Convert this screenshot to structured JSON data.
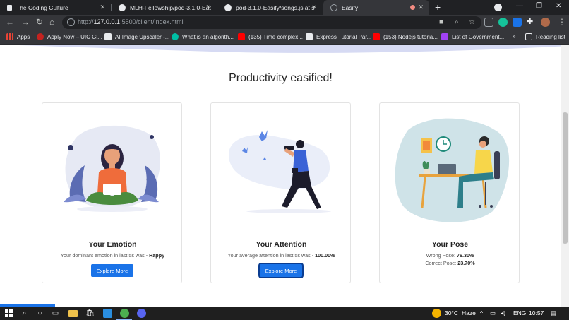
{
  "browser": {
    "tabs": [
      {
        "title": "The Coding Culture",
        "icon": "lock-icon",
        "icon_color": "#e8eaed"
      },
      {
        "title": "MLH-Fellowship/pod-3.1.0-Easif",
        "icon": "github-icon",
        "icon_color": "#e8eaed"
      },
      {
        "title": "pod-3.1.0-Easify/songs.js at song",
        "icon": "github-icon",
        "icon_color": "#e8eaed"
      },
      {
        "title": "Easify",
        "icon": "globe-icon",
        "icon_color": "#9aa0a6",
        "active": true
      }
    ],
    "url_host": "127.0.0.1",
    "url_path": ":5500/client/index.html",
    "url_scheme": "http://",
    "bookmarks": [
      {
        "label": "Apps",
        "color": "#ea4335"
      },
      {
        "label": "Apply Now – UIC Gl...",
        "color": "#c5221f"
      },
      {
        "label": "AI Image Upscaler -...",
        "color": "#111111"
      },
      {
        "label": "What is an algorith...",
        "color": "#00bfa5"
      },
      {
        "label": "(135) Time complex...",
        "color": "#ff0000"
      },
      {
        "label": "Express Tutorial Par...",
        "color": "#202124"
      },
      {
        "label": "(153) Nodejs tutoria...",
        "color": "#ff0000"
      },
      {
        "label": "List of Government...",
        "color": "#a142f4"
      }
    ],
    "overflow_label": "»",
    "reading_list_label": "Reading list"
  },
  "page": {
    "heading": "Productivity easified!",
    "cards": [
      {
        "title": "Your Emotion",
        "line1_prefix": "Your dominant emotion in last 5s was - ",
        "line1_value": "Happy",
        "button_label": "Explore More"
      },
      {
        "title": "Your Attention",
        "line1_prefix": "Your average attention in last 5s was - ",
        "line1_value": "100.00%",
        "button_label": "Explore More"
      },
      {
        "title": "Your Pose",
        "line1_prefix": "Wrong Pose: ",
        "line1_value": "76.30%",
        "line2_prefix": "Correct Pose: ",
        "line2_value": "23.70%"
      }
    ],
    "accent_color": "#1a73e8"
  },
  "taskbar": {
    "weather_temp": "30°C",
    "weather_desc": "Haze",
    "language": "ENG",
    "time": "10:57"
  }
}
